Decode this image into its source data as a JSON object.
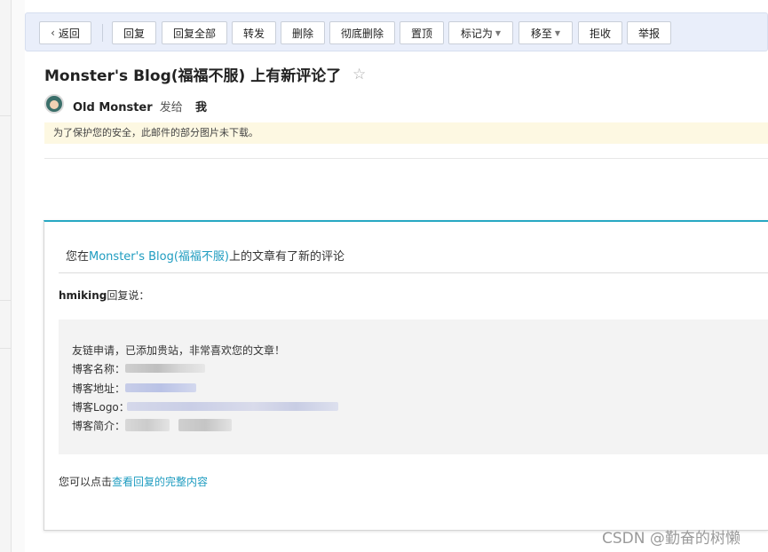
{
  "toolbar": {
    "back": "返回",
    "reply": "回复",
    "reply_all": "回复全部",
    "forward": "转发",
    "delete": "删除",
    "delete_permanently": "彻底删除",
    "pin": "置顶",
    "mark_as": "标记为",
    "move_to": "移至",
    "reject": "拒收",
    "report": "举报"
  },
  "email": {
    "subject": "Monster's Blog(福福不服) 上有新评论了",
    "sender_name": "Old Monster",
    "sent_to_label": "发给",
    "recipient": "我",
    "image_warning": "为了保护您的安全，此邮件的部分图片未下载。"
  },
  "body": {
    "title_prefix": "您在",
    "blog_link": "Monster's Blog(福福不服)",
    "title_suffix": "上的文章有了新的评论",
    "reply_author": "hmiking",
    "reply_said": "回复说：",
    "quote_line": "友链申请，已添加贵站，非常喜欢您的文章！",
    "blog_name_label": "博客名称：",
    "blog_url_label": "博客地址：",
    "blog_logo_label": "博客Logo：",
    "blog_intro_label": "博客简介：",
    "footer_prefix": "您可以点击",
    "footer_link": "查看回复的完整内容"
  },
  "watermark": "CSDN @勤奋的树懒",
  "colors": {
    "accent": "#27a8c3",
    "link": "#1f9cc0",
    "toolbar_bg": "#e9eefa",
    "warning_bg": "#fdf8e2"
  },
  "icons": {
    "back": "chevron-left-icon",
    "star": "star-outline-icon",
    "dropdown": "caret-down-icon"
  }
}
